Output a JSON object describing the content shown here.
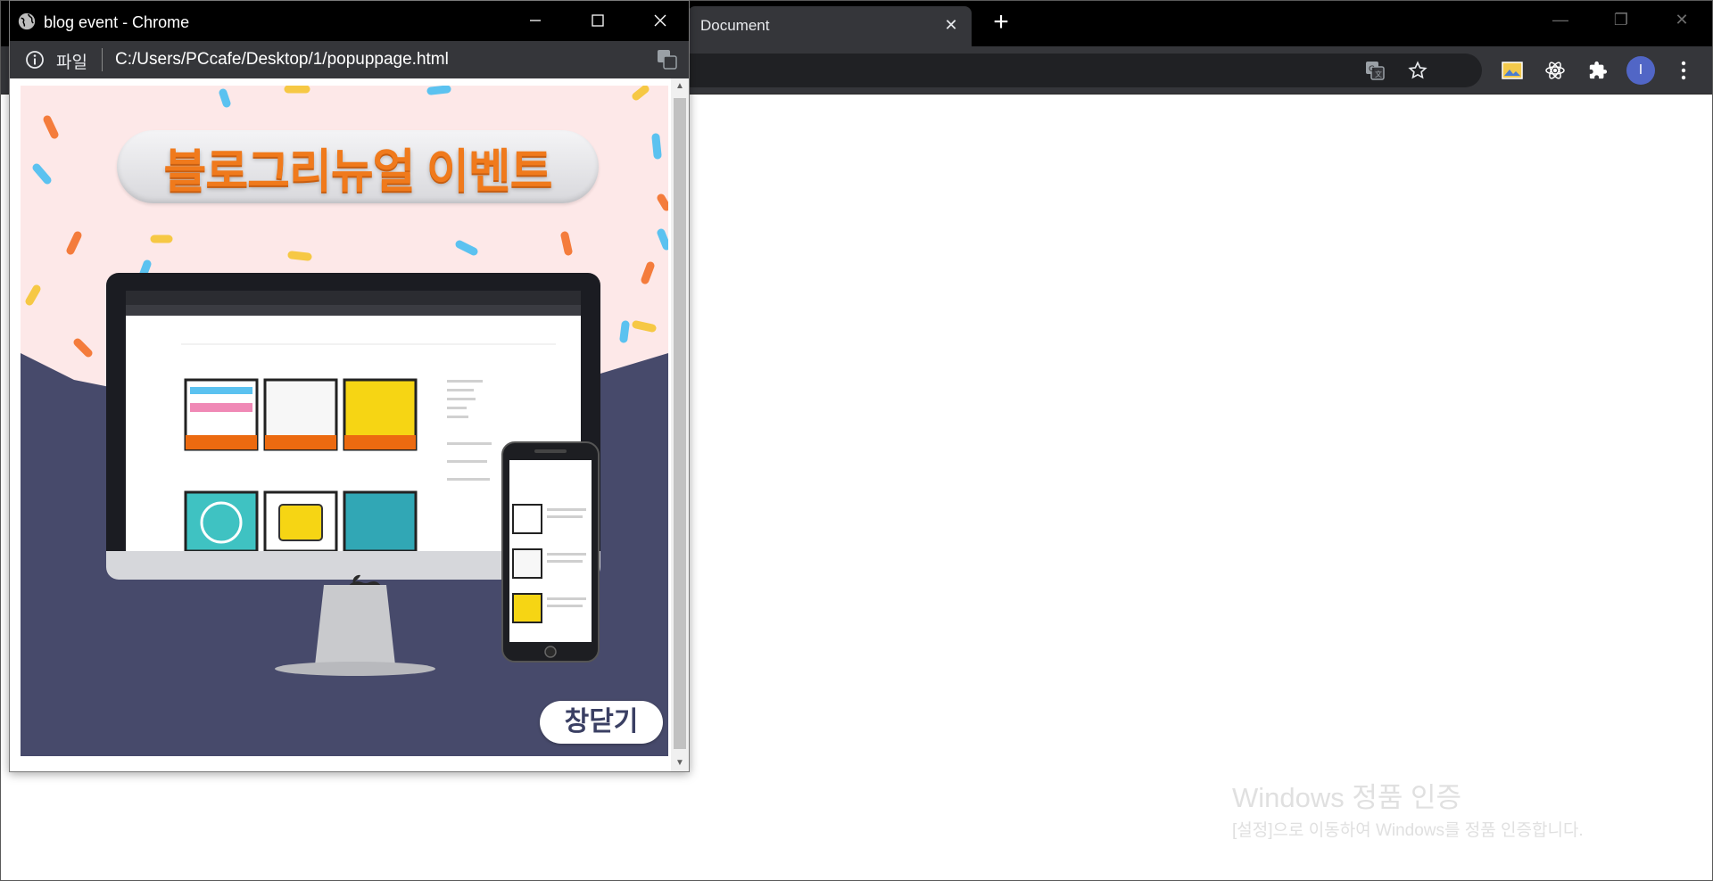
{
  "main_window": {
    "tab_title": "Document",
    "tab_close": "✕",
    "new_tab": "+",
    "controls": {
      "minimize": "—",
      "restore": "❐",
      "close": "✕"
    },
    "profile_initial": "I"
  },
  "popup": {
    "title": "blog event - Chrome",
    "address": {
      "scheme_label": "파일",
      "url": "C:/Users/PCcafe/Desktop/1/popuppage.html"
    },
    "banner": {
      "headline": "블로그리뉴얼 이벤트",
      "close_button": "창닫기",
      "background_top": "#fde8e8",
      "background_bottom": "#474a6b"
    }
  },
  "activation_watermark": {
    "title": "Windows 정품 인증",
    "subtitle": "[설정]으로 이동하여 Windows를 정품 인증합니다."
  },
  "icons": {
    "site_globe": "globe-icon",
    "info": "info-icon",
    "translate": "translate-icon",
    "star": "star-icon",
    "extensions": "puzzle-icon",
    "react": "react-icon",
    "image": "image-icon",
    "menu": "more-vert-icon"
  }
}
